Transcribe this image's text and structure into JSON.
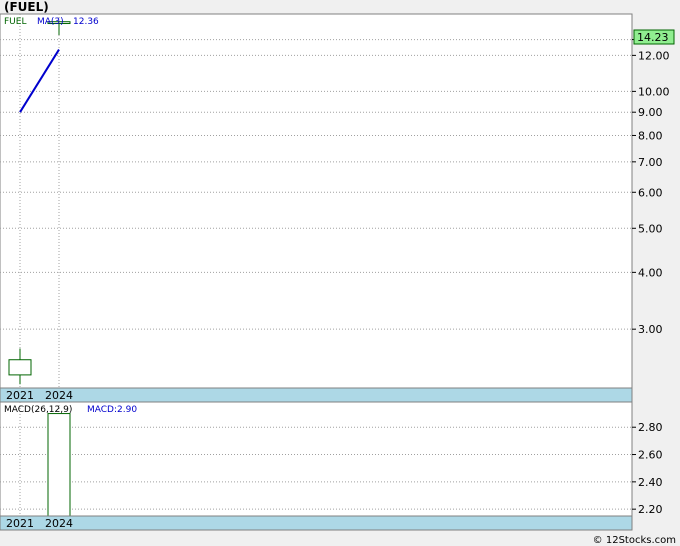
{
  "title": "(FUEL)",
  "footer": "© 12Stocks.com",
  "chart_data": [
    {
      "type": "candlestick",
      "scale": "log",
      "ticker": "FUEL",
      "ma_label": "MA(3)",
      "ma_value": "12.36",
      "last_price": "14.23",
      "x_labels": [
        "2021",
        "2024"
      ],
      "y_ticks": [
        3.0,
        4.0,
        5.0,
        6.0,
        7.0,
        8.0,
        9.0,
        10.0,
        12.0,
        13.0
      ],
      "ylim": [
        2.25,
        14.5
      ],
      "candles": [
        {
          "label": "2021",
          "open": 2.38,
          "close": 2.57,
          "high": 2.72,
          "low": 2.27
        },
        {
          "label": "2024",
          "open": 14.1,
          "close": 14.23,
          "high": 14.23,
          "low": 13.3
        }
      ],
      "ma_series": [
        9.0,
        12.36
      ],
      "colors": {
        "up": "#006400",
        "down": "#800000",
        "ma": "#0000cd",
        "price_tag": "#90ee90"
      },
      "grid": true
    },
    {
      "type": "bar",
      "indicator": "MACD(26,12,9)",
      "macd_label": "MACD:2.90",
      "x_labels": [
        "2021",
        "2024"
      ],
      "y_ticks": [
        2.2,
        2.4,
        2.6,
        2.8
      ],
      "ylim": [
        2.15,
        2.97
      ],
      "values": [
        null,
        2.9
      ],
      "grid": true
    }
  ]
}
